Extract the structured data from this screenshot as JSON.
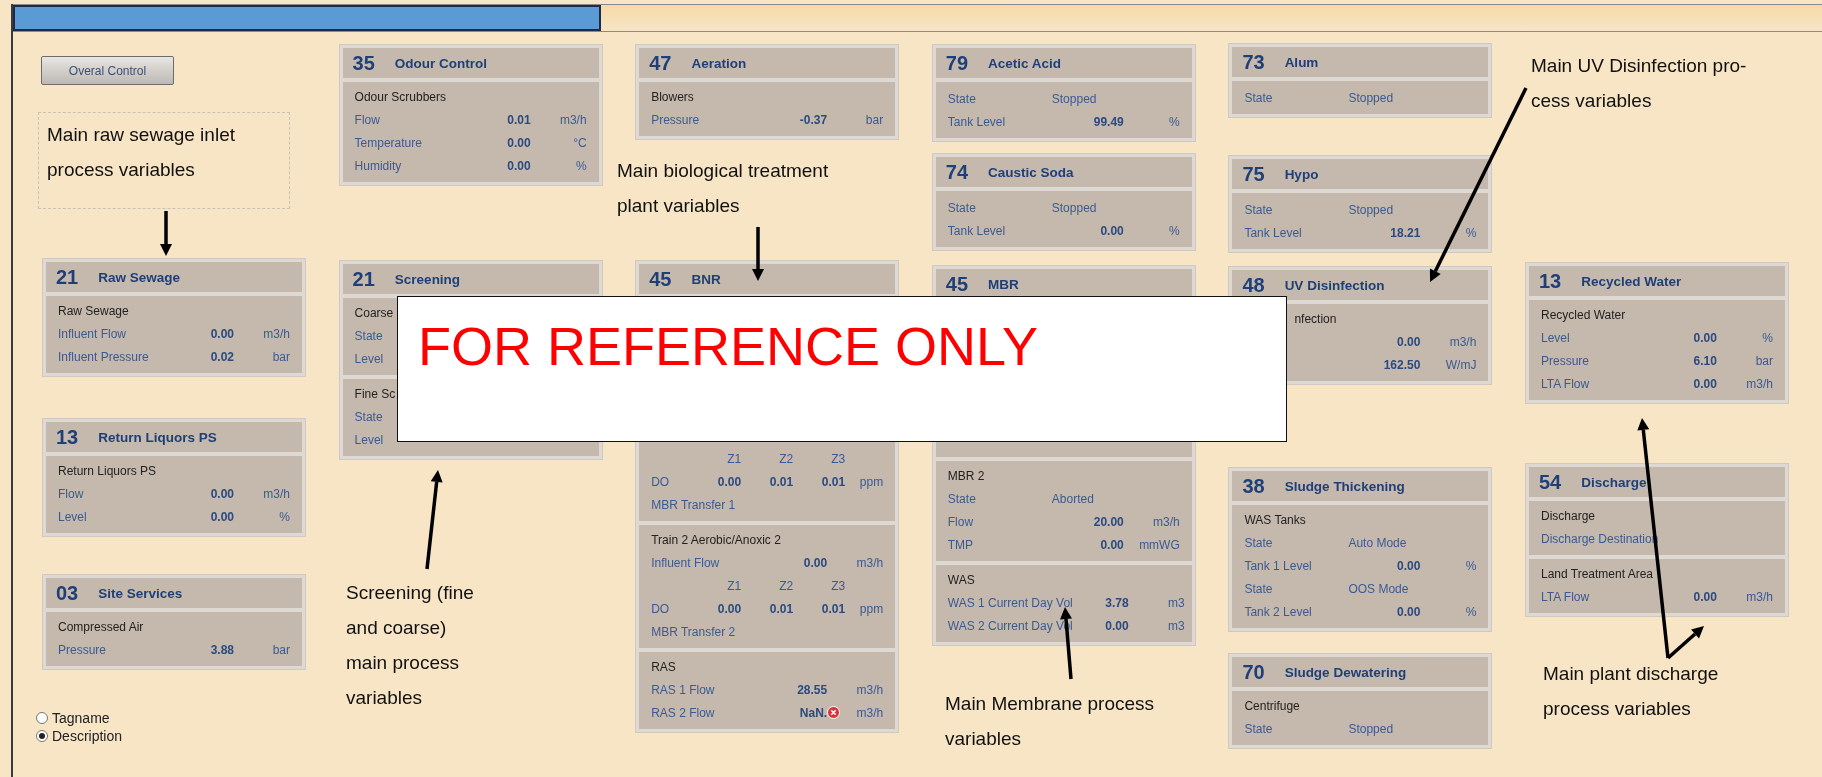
{
  "columns": [
    {
      "items": [
        {
          "kind": "button",
          "label": "Overal Control"
        },
        {
          "kind": "panel",
          "number": "21",
          "title": "Raw Sewage",
          "sections": [
            {
              "title": "Raw Sewage",
              "rows": [
                {
                  "kind": "reading",
                  "label": "Influent Flow",
                  "value": "0.00",
                  "unit": "m3/h"
                },
                {
                  "kind": "reading",
                  "label": "Influent Pressure",
                  "value": "0.02",
                  "unit": "bar"
                }
              ]
            }
          ]
        },
        {
          "kind": "panel",
          "number": "13",
          "title": "Return Liquors PS",
          "sections": [
            {
              "title": "Return Liquors PS",
              "rows": [
                {
                  "kind": "reading",
                  "label": "Flow",
                  "value": "0.00",
                  "unit": "m3/h"
                },
                {
                  "kind": "reading",
                  "label": "Level",
                  "value": "0.00",
                  "unit": "%"
                }
              ]
            }
          ]
        },
        {
          "kind": "panel",
          "number": "03",
          "title": "Site Services",
          "sections": [
            {
              "title": "Compressed Air",
              "rows": [
                {
                  "kind": "reading",
                  "label": "Pressure",
                  "value": "3.88",
                  "unit": "bar"
                }
              ]
            }
          ]
        },
        {
          "kind": "radio_group",
          "options": [
            {
              "label": "Tagname",
              "selected": false
            },
            {
              "label": "Description",
              "selected": true
            }
          ]
        }
      ]
    },
    {
      "items": [
        {
          "kind": "panel",
          "number": "35",
          "title": "Odour Control",
          "sections": [
            {
              "title": "Odour Scrubbers",
              "rows": [
                {
                  "kind": "reading",
                  "label": "Flow",
                  "value": "0.01",
                  "unit": "m3/h"
                },
                {
                  "kind": "reading",
                  "label": "Temperature",
                  "value": "0.00",
                  "unit": "°C"
                },
                {
                  "kind": "reading",
                  "label": "Humidity",
                  "value": "0.00",
                  "unit": "%"
                }
              ]
            }
          ]
        },
        {
          "kind": "panel",
          "number": "21",
          "title": "Screening",
          "sections": [
            {
              "title": "Coarse",
              "rows": [
                {
                  "kind": "reading",
                  "label": "State"
                },
                {
                  "kind": "reading",
                  "label": "Level"
                }
              ]
            },
            {
              "title": "Fine Sc",
              "rows": [
                {
                  "kind": "reading",
                  "label": "State"
                },
                {
                  "kind": "reading",
                  "label": "Level"
                }
              ]
            }
          ]
        }
      ]
    },
    {
      "items": [
        {
          "kind": "panel",
          "number": "47",
          "title": "Aeration",
          "sections": [
            {
              "title": "Blowers",
              "rows": [
                {
                  "kind": "reading",
                  "label": "Pressure",
                  "value": "-0.37",
                  "unit": "bar"
                }
              ]
            }
          ]
        },
        {
          "kind": "panel",
          "number": "45",
          "title": "BNR",
          "sections": [
            {
              "obscured": true,
              "rows": [
                {
                  "kind": "zones",
                  "zones": [
                    "Z1",
                    "Z2",
                    "Z3"
                  ]
                },
                {
                  "kind": "zone_reading",
                  "label": "DO",
                  "values": [
                    "0.00",
                    "0.01",
                    "0.01"
                  ],
                  "unit": "ppm"
                },
                {
                  "kind": "note",
                  "label": "MBR Transfer 1"
                }
              ]
            },
            {
              "title": "Train 2 Aerobic/Anoxic 2",
              "rows": [
                {
                  "kind": "reading",
                  "label": "Influent Flow",
                  "value": "0.00",
                  "unit": "m3/h"
                },
                {
                  "kind": "zones",
                  "zones": [
                    "Z1",
                    "Z2",
                    "Z3"
                  ]
                },
                {
                  "kind": "zone_reading",
                  "label": "DO",
                  "values": [
                    "0.00",
                    "0.01",
                    "0.01"
                  ],
                  "unit": "ppm"
                },
                {
                  "kind": "note",
                  "label": "MBR Transfer 2"
                }
              ]
            },
            {
              "title": "RAS",
              "rows": [
                {
                  "kind": "reading",
                  "label": "RAS 1 Flow",
                  "value": "28.55",
                  "unit": "m3/h",
                  "alarm": false
                },
                {
                  "kind": "reading",
                  "label": "RAS 2 Flow",
                  "value": "NaN.",
                  "unit": "m3/h",
                  "alarm": true
                }
              ]
            }
          ]
        }
      ]
    },
    {
      "items": [
        {
          "kind": "panel",
          "number": "79",
          "title": "Acetic Acid",
          "sections": [
            {
              "rows": [
                {
                  "kind": "state",
                  "label": "State",
                  "value": "Stopped"
                },
                {
                  "kind": "reading",
                  "label": "Tank Level",
                  "value": "99.49",
                  "unit": "%"
                }
              ]
            }
          ]
        },
        {
          "kind": "panel",
          "number": "74",
          "title": "Caustic Soda",
          "sections": [
            {
              "rows": [
                {
                  "kind": "state",
                  "label": "State",
                  "value": "Stopped"
                },
                {
                  "kind": "reading",
                  "label": "Tank Level",
                  "value": "0.00",
                  "unit": "%"
                }
              ]
            }
          ]
        },
        {
          "kind": "panel",
          "number": "45",
          "title": "MBR",
          "sections": [
            {
              "obscured": true
            },
            {
              "title": "MBR 2",
              "rows": [
                {
                  "kind": "state",
                  "label": "State",
                  "value": "Aborted"
                },
                {
                  "kind": "reading",
                  "label": "Flow",
                  "value": "20.00",
                  "unit": "m3/h"
                },
                {
                  "kind": "reading",
                  "label": "TMP",
                  "value": "0.00",
                  "unit": "mmWG"
                }
              ]
            },
            {
              "title": "WAS",
              "rows": [
                {
                  "kind": "reading",
                  "label": "WAS 1 Current Day Vol",
                  "value": "3.78",
                  "unit": "m3"
                },
                {
                  "kind": "reading",
                  "label": "WAS 2 Current Day Vol",
                  "value": "0.00",
                  "unit": "m3"
                }
              ]
            }
          ]
        }
      ]
    },
    {
      "items": [
        {
          "kind": "panel",
          "number": "73",
          "title": "Alum",
          "sections": [
            {
              "rows": [
                {
                  "kind": "state",
                  "label": "State",
                  "value": "Stopped"
                }
              ]
            }
          ]
        },
        {
          "kind": "panel",
          "number": "75",
          "title": "Hypo",
          "sections": [
            {
              "rows": [
                {
                  "kind": "state",
                  "label": "State",
                  "value": "Stopped"
                },
                {
                  "kind": "reading",
                  "label": "Tank Level",
                  "value": "18.21",
                  "unit": "%"
                }
              ]
            }
          ]
        },
        {
          "kind": "panel",
          "number": "48",
          "title": "UV Disinfection",
          "sections": [
            {
              "title": "nfection",
              "partial": true,
              "rows": [
                {
                  "kind": "reading",
                  "value": "0.00",
                  "unit": "m3/h"
                },
                {
                  "kind": "reading",
                  "value": "162.50",
                  "unit": "W/mJ"
                }
              ]
            }
          ]
        },
        {
          "kind": "panel",
          "number": "38",
          "title": "Sludge Thickening",
          "sections": [
            {
              "title": "WAS Tanks",
              "rows": [
                {
                  "kind": "state",
                  "label": "State",
                  "value": "Auto Mode"
                },
                {
                  "kind": "reading",
                  "label": "Tank 1 Level",
                  "value": "0.00",
                  "unit": "%"
                },
                {
                  "kind": "state",
                  "label": "State",
                  "value": "OOS Mode"
                },
                {
                  "kind": "reading",
                  "label": "Tank 2 Level",
                  "value": "0.00",
                  "unit": "%"
                }
              ]
            }
          ]
        },
        {
          "kind": "panel",
          "number": "70",
          "title": "Sludge Dewatering",
          "sections": [
            {
              "title": "Centrifuge",
              "rows": [
                {
                  "kind": "state",
                  "label": "State",
                  "value": "Stopped"
                }
              ]
            }
          ]
        }
      ]
    },
    {
      "items": [
        {
          "kind": "panel",
          "number": "13",
          "title": "Recycled Water",
          "sections": [
            {
              "title": "Recycled Water",
              "rows": [
                {
                  "kind": "reading",
                  "label": "Level",
                  "value": "0.00",
                  "unit": "%"
                },
                {
                  "kind": "reading",
                  "label": "Pressure",
                  "value": "6.10",
                  "unit": "bar"
                },
                {
                  "kind": "reading",
                  "label": "LTA Flow",
                  "value": "0.00",
                  "unit": "m3/h"
                }
              ]
            }
          ]
        },
        {
          "kind": "panel",
          "number": "54",
          "title": "Discharge",
          "sections": [
            {
              "title": "Discharge",
              "rows": [
                {
                  "kind": "note",
                  "label": "Discharge Destination"
                }
              ]
            },
            {
              "title": "Land Treatment Area",
              "rows": [
                {
                  "kind": "reading",
                  "label": "LTA Flow",
                  "value": "0.00",
                  "unit": "m3/h"
                }
              ]
            }
          ]
        }
      ]
    }
  ],
  "callouts": [
    {
      "kind": "boxed",
      "text": "Main raw sewage inlet process variables"
    },
    {
      "kind": "plain",
      "text": "Screening (fine and coarse) main process variables"
    },
    {
      "kind": "plain",
      "text": "Main biological treatment plant variables"
    },
    {
      "kind": "plain",
      "text": "Main Membrane process variables"
    },
    {
      "kind": "plain",
      "text": "Main UV Disinfection pro-cess variables"
    },
    {
      "kind": "plain",
      "text": "Main plant discharge process variables"
    }
  ],
  "notice": {
    "text": "FOR REFERENCE ONLY"
  }
}
